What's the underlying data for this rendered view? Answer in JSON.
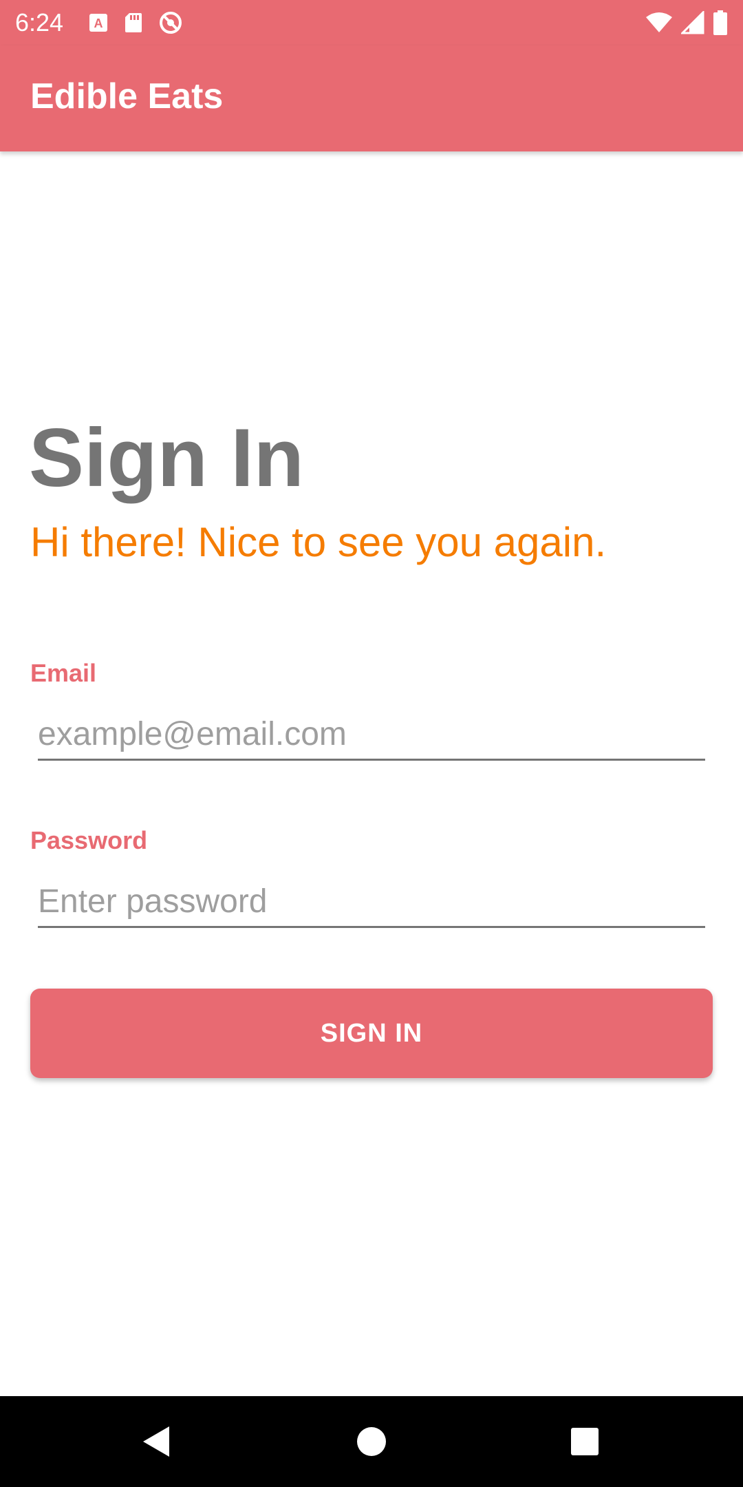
{
  "status_bar": {
    "time": "6:24",
    "left_icons": [
      "text-a-icon",
      "sd-card-icon",
      "sync-blocked-icon"
    ],
    "right_icons": [
      "wifi-icon",
      "cell-signal-icon",
      "battery-icon"
    ]
  },
  "app_bar": {
    "title": "Edible Eats"
  },
  "sign_in": {
    "heading": "Sign In",
    "subheading": "Hi there! Nice to see you again.",
    "email_label": "Email",
    "email_placeholder": "example@email.com",
    "email_value": "",
    "password_label": "Password",
    "password_placeholder": "Enter password",
    "password_value": "",
    "button_label": "SIGN IN"
  },
  "nav_bar": {
    "icons": [
      "back-icon",
      "home-icon",
      "recents-icon"
    ]
  },
  "colors": {
    "primary": "#e86a72",
    "accent": "#f57c00",
    "heading_gray": "#757575",
    "placeholder_gray": "#9e9e9e"
  }
}
